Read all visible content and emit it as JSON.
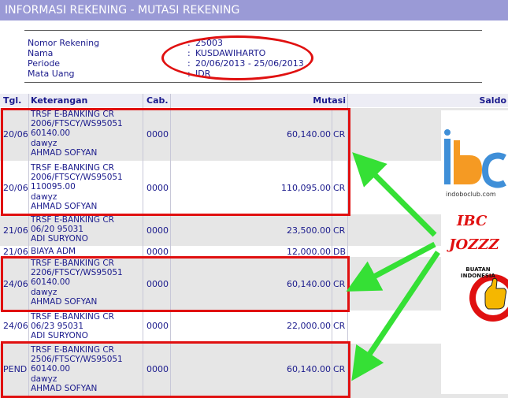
{
  "header": {
    "title": "INFORMASI REKENING - MUTASI REKENING"
  },
  "account": {
    "nomor_label": "Nomor Rekening",
    "nomor_value": "25003",
    "nama_label": "Nama",
    "nama_value": "KUSDAWIHARTO",
    "periode_label": "Periode",
    "periode_value": "20/06/2013 - 25/06/2013",
    "mata_uang_label": "Mata Uang",
    "mata_uang_value": "IDR",
    "colon": ":"
  },
  "table": {
    "headers": {
      "tgl": "Tgl.",
      "keterangan": "Keterangan",
      "cab": "Cab.",
      "mutasi": "Mutasi",
      "saldo": "Saldo"
    },
    "rows": [
      {
        "date": "20/06",
        "desc": "TRSF E-BANKING CR\n2006/FTSCY/WS95051\n60140.00\ndawyz\nAHMAD SOFYAN",
        "cab": "0000",
        "amount": "60,140.00",
        "dc": "CR"
      },
      {
        "date": "20/06",
        "desc": "TRSF E-BANKING CR\n2006/FTSCY/WS95051\n110095.00\ndawyz\nAHMAD SOFYAN",
        "cab": "0000",
        "amount": "110,095.00",
        "dc": "CR"
      },
      {
        "date": "21/06",
        "desc": "TRSF E-BANKING CR\n06/20 95031\nADI SURYONO",
        "cab": "0000",
        "amount": "23,500.00",
        "dc": "CR"
      },
      {
        "date": "21/06",
        "desc": "BIAYA ADM",
        "cab": "0000",
        "amount": "12,000.00",
        "dc": "DB"
      },
      {
        "date": "24/06",
        "desc": "TRSF E-BANKING CR\n2206/FTSCY/WS95051\n60140.00\ndawyz\nAHMAD SOFYAN",
        "cab": "0000",
        "amount": "60,140.00",
        "dc": "CR"
      },
      {
        "date": "24/06",
        "desc": "TRSF E-BANKING CR\n06/23 95031\nADI SURYONO",
        "cab": "0000",
        "amount": "22,000.00",
        "dc": "CR"
      },
      {
        "date": "PEND",
        "desc": "TRSF E-BANKING CR\n2506/FTSCY/WS95051\n60140.00\ndawyz\nAHMAD SOFYAN",
        "cab": "0000",
        "amount": "60,140.00",
        "dc": "CR"
      }
    ]
  },
  "ads": {
    "ibc_logo": "ibc",
    "ibc_site": "indoboclub.com",
    "ibc_line1": "IBC",
    "ibc_line2": "JOZZZ",
    "badge_text": "BUATAN INDONESIA"
  },
  "colors": {
    "title_bg": "#9a9ad6",
    "text": "#1a1a8c",
    "highlight": "#e01010",
    "arrow": "#35e035",
    "ibc_blue": "#3f8fd8",
    "ibc_orange": "#f59a23"
  }
}
